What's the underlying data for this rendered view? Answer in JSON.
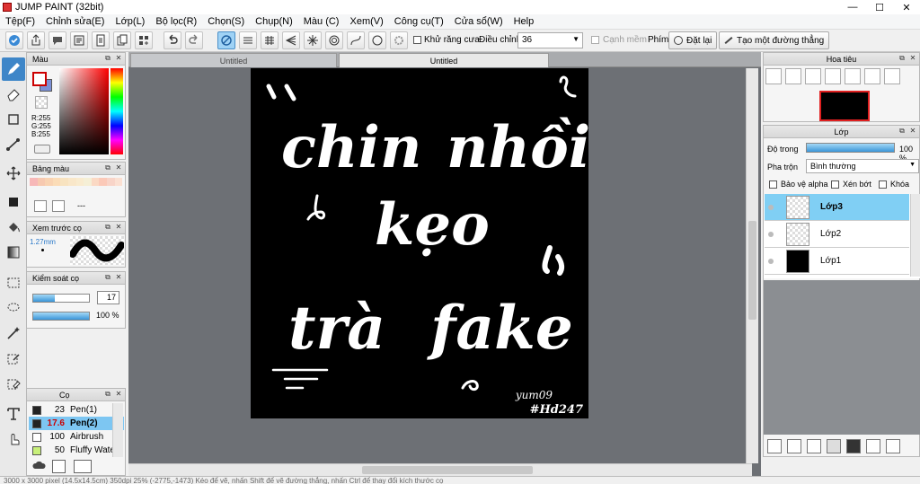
{
  "app": {
    "title": "JUMP PAINT (32bit)"
  },
  "window_controls": {
    "minimize": "—",
    "maximize": "☐",
    "close": "✕"
  },
  "menu": [
    "Tệp(F)",
    "Chỉnh sửa(E)",
    "Lớp(L)",
    "Bộ lọc(R)",
    "Chọn(S)",
    "Chụp(N)",
    "Màu (C)",
    "Xem(V)",
    "Công cụ(T)",
    "Cửa sổ(W)",
    "Help"
  ],
  "toolbar": {
    "antialias_label": "Khử răng cưa",
    "correction_label": "Điều chỉnh",
    "correction_value": "36",
    "edge_label": "Cạnh mềm",
    "keys_label": "Phím",
    "reset_label": "Đặt lại",
    "new_ruler_label": "Tạo một đường thẳng"
  },
  "tabs": [
    "Untitled",
    "Untitled"
  ],
  "color_panel": {
    "title": "Màu",
    "r": "R:255",
    "g": "G:255",
    "b": "B:255",
    "primary": "#ffffff",
    "secondary": "#7b8fd6"
  },
  "palette_panel": {
    "title": "Bảng màu",
    "swatches": [
      "#f7b8b8",
      "#f7c9b0",
      "#f9d3b2",
      "#fbdcb7",
      "#f8e3c0",
      "#f9e7c9",
      "#f9ebcf",
      "#f5efd6",
      "#fbd9c4",
      "#fbc9b8",
      "#f8d4c8",
      "#fbe0d2"
    ],
    "label": "---"
  },
  "brush_preview": {
    "title": "Xem trước cọ",
    "size": "1.27mm"
  },
  "brush_control": {
    "title": "Kiểm soát cọ",
    "size_value": "17",
    "size_fraction": 0.38,
    "opacity_label": "100 %",
    "opacity_fraction": 1.0
  },
  "brush_panel": {
    "title": "Cọ",
    "items": [
      {
        "size": "23",
        "name": "Pen(1)",
        "color": "#222222"
      },
      {
        "size": "17.6",
        "name": "Pen(2)",
        "color": "#222222"
      },
      {
        "size": "100",
        "name": "Airbrush",
        "color": "#ffffff"
      },
      {
        "size": "50",
        "name": "Fluffy Water",
        "color": "#c8f07a"
      }
    ]
  },
  "navigator": {
    "title": "Hoa tiêu"
  },
  "layer_panel": {
    "title": "Lớp",
    "opacity_label": "Độ trong",
    "opacity_value": "100 %",
    "opacity_fraction": 1.0,
    "blend_label": "Pha trộn",
    "blend_value": "Bình thường",
    "protect_alpha": "Bảo vệ alpha",
    "clip": "Xén bớt",
    "lock": "Khóa",
    "layers": [
      {
        "name": "Lớp3",
        "thumb": "transparent",
        "active": true
      },
      {
        "name": "Lớp2",
        "thumb": "transparent",
        "active": false
      },
      {
        "name": "Lớp1",
        "thumb": "black",
        "active": false
      }
    ]
  },
  "artwork": {
    "line1a": "chin",
    "line1b": "nhồi",
    "line2": "kẹo",
    "line3a": "trà",
    "line3b": "fake",
    "sig1": "yum09",
    "sig2": "#Hd247"
  },
  "status": "3000 x 3000 pixel (14.5x14.5cm) 350dpi 25% (-2775,-1473) Kéo để vẽ, nhấn Shift để vẽ đường thẳng, nhấn Ctrl để thay đổi kích thước cọ"
}
